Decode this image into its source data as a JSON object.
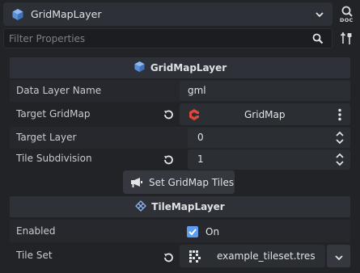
{
  "header": {
    "node_title": "GridMapLayer",
    "doc_label": "DOC"
  },
  "filter": {
    "placeholder": "Filter Properties"
  },
  "sections": {
    "gridmap_layer": {
      "title": "GridMapLayer"
    },
    "tilemap_layer": {
      "title": "TileMapLayer"
    }
  },
  "properties": {
    "data_layer_name": {
      "label": "Data Layer Name",
      "value": "gml"
    },
    "target_gridmap": {
      "label": "Target GridMap",
      "value": "GridMap"
    },
    "target_layer": {
      "label": "Target Layer",
      "value": "0"
    },
    "tile_subdivision": {
      "label": "Tile Subdivision",
      "value": "1"
    },
    "set_tiles_button": {
      "label": "Set GridMap Tiles"
    },
    "enabled": {
      "label": "Enabled",
      "value": "On",
      "checked": true
    },
    "tile_set": {
      "label": "Tile Set",
      "value": "example_tileset.tres"
    }
  },
  "colors": {
    "accent_blue": "#5b9df0",
    "gridmap_red": "#e0463c",
    "background": "#212327"
  }
}
